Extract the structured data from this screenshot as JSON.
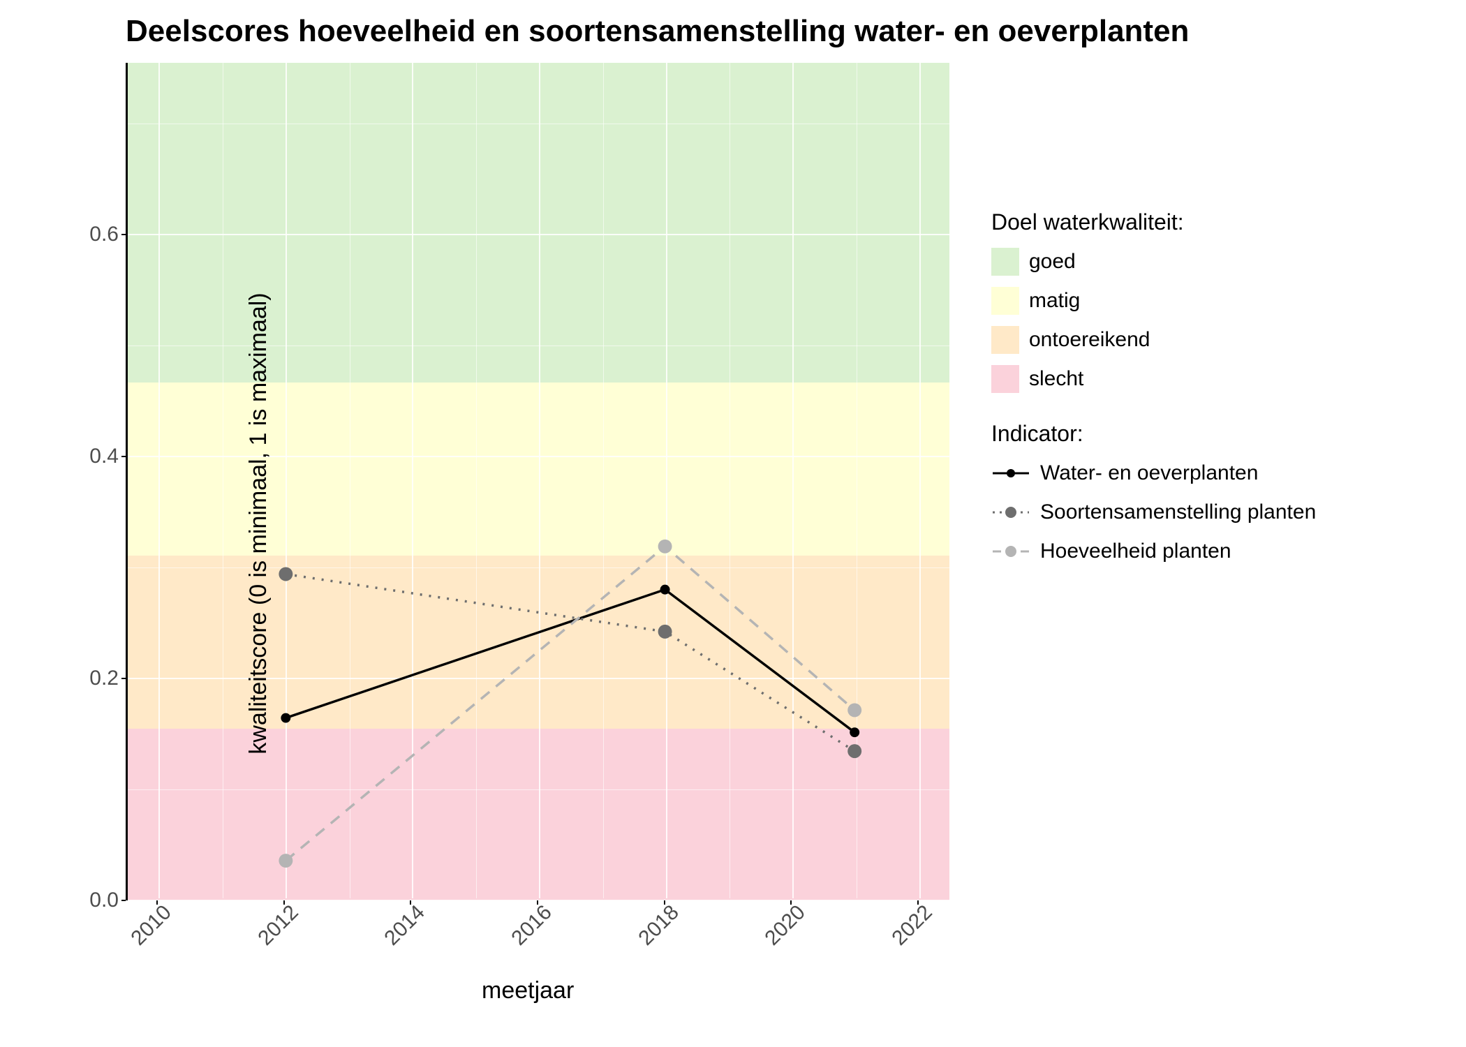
{
  "title": "Deelscores hoeveelheid en soortensamenstelling water- en oeverplanten",
  "xlabel": "meetjaar",
  "ylabel": "kwaliteitscore (0 is minimaal, 1 is maximaal)",
  "xticks": [
    "2010",
    "2012",
    "2014",
    "2016",
    "2018",
    "2020",
    "2022"
  ],
  "yticks": [
    "0.0",
    "0.2",
    "0.4",
    "0.6"
  ],
  "legend_bands_title": "Doel waterkwaliteit:",
  "legend_bands": {
    "goed": "goed",
    "matig": "matig",
    "ontoereikend": "ontoereikend",
    "slecht": "slecht"
  },
  "legend_indicator_title": "Indicator:",
  "legend_indicators": {
    "water": "Water- en oeverplanten",
    "soorten": "Soortensamenstelling planten",
    "hoeveelheid": "Hoeveelheid planten"
  },
  "chart_data": {
    "type": "line",
    "title": "Deelscores hoeveelheid en soortensamenstelling water- en oeverplanten",
    "xlabel": "meetjaar",
    "ylabel": "kwaliteitscore (0 is minimaal, 1 is maximaal)",
    "x_range": [
      2009.5,
      2022.5
    ],
    "y_range": [
      0.0,
      0.755
    ],
    "x_ticks": [
      2010,
      2012,
      2014,
      2016,
      2018,
      2020,
      2022
    ],
    "y_ticks": [
      0.0,
      0.2,
      0.4,
      0.6
    ],
    "bands": [
      {
        "name": "slecht",
        "y0": 0.0,
        "y1": 0.155,
        "color": "#fbd2db"
      },
      {
        "name": "ontoereikend",
        "y0": 0.155,
        "y1": 0.311,
        "color": "#ffe9c8"
      },
      {
        "name": "matig",
        "y0": 0.311,
        "y1": 0.467,
        "color": "#ffffd6"
      },
      {
        "name": "goed",
        "y0": 0.467,
        "y1": 0.755,
        "color": "#daf1d0"
      }
    ],
    "series": [
      {
        "name": "Water- en oeverplanten",
        "color": "#000000",
        "dash": "solid",
        "point_size": 7,
        "x": [
          2012,
          2018,
          2021
        ],
        "y": [
          0.163,
          0.279,
          0.15
        ]
      },
      {
        "name": "Soortensamenstelling planten",
        "color": "#6e6e6e",
        "dash": "dotted",
        "point_size": 10,
        "x": [
          2012,
          2018,
          2021
        ],
        "y": [
          0.293,
          0.241,
          0.133
        ]
      },
      {
        "name": "Hoeveelheid planten",
        "color": "#b4b4b4",
        "dash": "dashed",
        "point_size": 10,
        "x": [
          2012,
          2018,
          2021
        ],
        "y": [
          0.034,
          0.318,
          0.17
        ]
      }
    ],
    "legend_position": "right",
    "grid": true
  }
}
